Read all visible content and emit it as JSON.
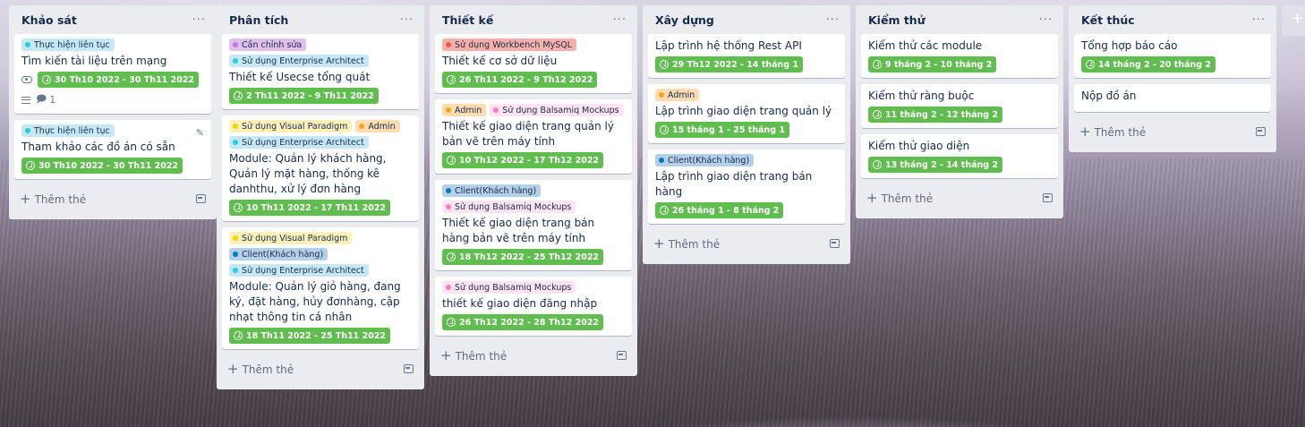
{
  "colors": {
    "label_sky": "#c6e8f5",
    "dot_sky": "#29cce5",
    "label_purple": "#dfc0eb",
    "dot_purple": "#c377e0",
    "label_yellow": "#fbf1b8",
    "dot_yellow": "#f2d600",
    "label_orange": "#fcdcb0",
    "dot_orange": "#ff9f1a",
    "label_red": "#f5b1a9",
    "dot_red": "#eb5a46",
    "label_pink": "#fde4f0",
    "dot_pink": "#ff78cb",
    "label_blue": "#b4cfe8",
    "dot_blue": "#0079bf",
    "label_sky2": "#cdeef8",
    "date_green": "#61bd4f"
  },
  "add_card_label": "Thêm thẻ",
  "add_list_label": "+",
  "lists": [
    {
      "title": "Khảo sát",
      "menu": "···",
      "cards": [
        {
          "labels": [
            {
              "text": "Thực hiện liên tục",
              "color": "sky"
            }
          ],
          "title": "Tìm kiến tài liệu trên mạng",
          "date": "30 Th10 2022 - 30 Th11 2022",
          "watch_icon": "eye-icon",
          "description_icon": "description-icon",
          "comments": "1"
        },
        {
          "labels": [
            {
              "text": "Thực hiện liên tục",
              "color": "sky"
            }
          ],
          "title": "Tham khảo các đồ án có sẵn",
          "date": "30 Th10 2022 - 30 Th11 2022",
          "edit_icon": "pencil-icon"
        }
      ]
    },
    {
      "title": "Phân tích",
      "menu": "···",
      "cards": [
        {
          "labels": [
            {
              "text": "Cần chỉnh sửa",
              "color": "purple"
            },
            {
              "text": "Sử dụng Enterprise Architect",
              "color": "sky"
            }
          ],
          "title": "Thiết kế Usecse tổng quát",
          "date": "2 Th11 2022 - 9 Th11 2022"
        },
        {
          "labels": [
            {
              "text": "Sử dụng Visual Paradigm",
              "color": "yellow"
            },
            {
              "text": "Admin",
              "color": "orange"
            },
            {
              "text": "Sử dụng Enterprise Architect",
              "color": "sky"
            }
          ],
          "title": "Module: Quản lý khách hàng, Quản lý mặt hàng, thống kê danhthu, xử lý đơn hàng",
          "date": "10 Th11 2022 - 17 Th11 2022"
        },
        {
          "labels": [
            {
              "text": "Sử dụng Visual Paradigm",
              "color": "yellow"
            },
            {
              "text": "Client(Khách hàng)",
              "color": "blue"
            },
            {
              "text": "Sử dụng Enterprise Architect",
              "color": "sky"
            }
          ],
          "title": "Module: Quản lý giỏ hàng, đang ký, đặt hàng, hủy đơnhàng, cập nhạt thông tin cá nhân",
          "date": "18 Th11 2022 - 25 Th11 2022"
        }
      ]
    },
    {
      "title": "Thiết kế",
      "menu": "···",
      "cards": [
        {
          "labels": [
            {
              "text": "Sử dụng Workbench MySQL",
              "color": "red"
            }
          ],
          "title": "Thiết kế cơ sở dữ liệu",
          "date": "26 Th11 2022 - 9 Th12 2022"
        },
        {
          "labels": [
            {
              "text": "Admin",
              "color": "orange"
            },
            {
              "text": "Sử dụng Balsamiq Mockups",
              "color": "pink"
            }
          ],
          "title": "Thiết kế giao diện trang quản lý bản vẽ trên máy tính",
          "date": "10 Th12 2022 - 17 Th12 2022"
        },
        {
          "labels": [
            {
              "text": "Client(Khách hàng)",
              "color": "blue"
            },
            {
              "text": "Sử dụng Balsamiq Mockups",
              "color": "pink"
            }
          ],
          "title": "Thiết kế giao diện trang bán hàng bản vẽ trên máy tính",
          "date": "18 Th12 2022 - 25 Th12 2022"
        },
        {
          "labels": [
            {
              "text": "Sử dụng Balsamiq Mockups",
              "color": "pink"
            }
          ],
          "title": "thiết kế giao diện đăng nhập",
          "date": "26 Th12 2022 - 28 Th12 2022"
        }
      ]
    },
    {
      "title": "Xây dựng",
      "menu": "···",
      "cards": [
        {
          "labels": [],
          "title": "Lập trình hệ thống Rest API",
          "date": "29 Th12 2022 - 14 tháng 1"
        },
        {
          "labels": [
            {
              "text": "Admin",
              "color": "orange"
            }
          ],
          "title": "Lập trình giao diện trang quản lý",
          "date": "15 tháng 1 - 25 tháng 1"
        },
        {
          "labels": [
            {
              "text": "Client(Khách hàng)",
              "color": "blue"
            }
          ],
          "title": "Lập trình giao diện trang bán hàng",
          "date": "26 tháng 1 - 8 tháng 2"
        }
      ]
    },
    {
      "title": "Kiểm thử",
      "menu": "···",
      "cards": [
        {
          "labels": [],
          "title": "Kiểm thử các module",
          "date": "9 tháng 2 - 10 tháng 2"
        },
        {
          "labels": [],
          "title": "Kiểm thử ràng buộc",
          "date": "11 tháng 2 - 12 tháng 2"
        },
        {
          "labels": [],
          "title": "Kiểm thử giao diện",
          "date": "13 tháng 2 - 14 tháng 2"
        }
      ]
    },
    {
      "title": "Kết thúc",
      "menu": "···",
      "cards": [
        {
          "labels": [],
          "title": "Tổng hợp báo cáo",
          "date": "14 tháng 2 - 20 tháng 2"
        },
        {
          "labels": [],
          "title": "Nộp đồ án"
        }
      ]
    }
  ]
}
